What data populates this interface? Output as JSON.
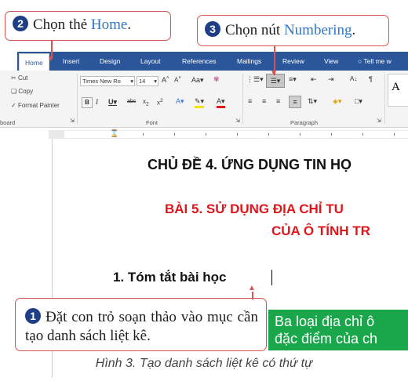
{
  "callouts": {
    "step2": {
      "badge": "2",
      "prefix": "Chọn thẻ ",
      "highlight": "Home",
      "suffix": "."
    },
    "step3": {
      "badge": "3",
      "prefix": "Chọn nút ",
      "highlight": "Numbering",
      "suffix": "."
    },
    "step1": {
      "badge": "1",
      "text": "Đặt con trỏ soạn thảo vào mục cần tạo danh sách liệt kê."
    }
  },
  "ribbon": {
    "tabs": [
      "Home",
      "Insert",
      "Design",
      "Layout",
      "References",
      "Mailings",
      "Review",
      "View"
    ],
    "tell_me": "Tell me w",
    "clipboard": {
      "cut": "Cut",
      "copy": "Copy",
      "format_painter": "Format Painter",
      "group": "board"
    },
    "font": {
      "name": "Times New Ro",
      "size": "14",
      "group": "Font"
    },
    "paragraph": {
      "group": "Paragraph"
    },
    "styles": {
      "preview": "A"
    }
  },
  "document": {
    "topic": "CHỦ ĐỀ 4. ỨNG DỤNG TIN HỌ",
    "lesson_line1": "BÀI 5. SỬ DỤNG ĐỊA CHỈ TU",
    "lesson_line2": "CỦA Ô TÍNH TR",
    "heading": "1.  Tóm tắt bài học",
    "green_line1": "Ba loại địa chỉ ô",
    "green_line2": "đặc điểm của ch"
  },
  "caption": "Hình 3. Tạo danh sách liệt kê có thứ tự",
  "colors": {
    "accent_red": "#d9534f",
    "ribbon_blue": "#2b579a",
    "badge_navy": "#1e3f86",
    "doc_red": "#e0161d",
    "green": "#1aa64a"
  }
}
